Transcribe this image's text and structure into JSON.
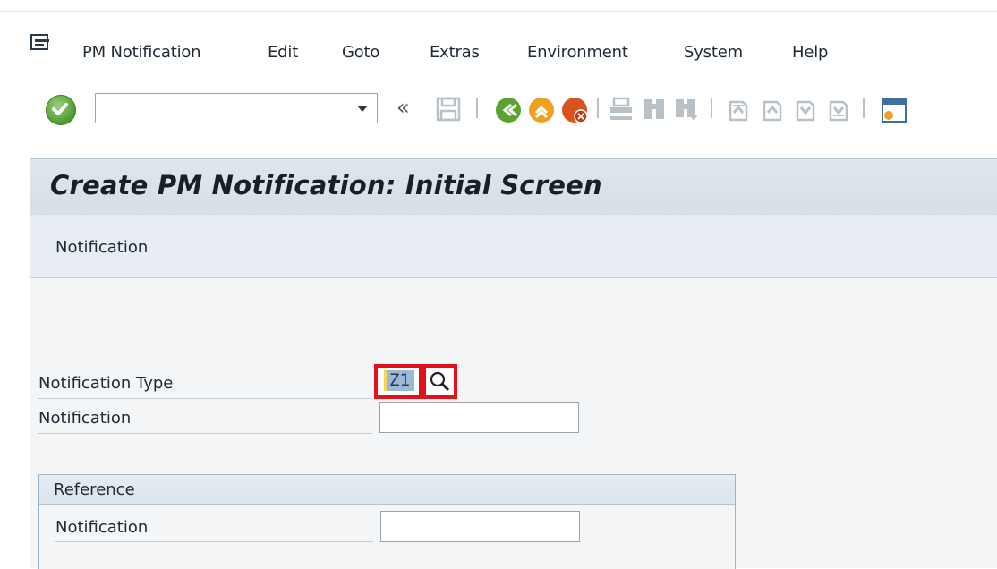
{
  "menubar": {
    "items": [
      {
        "label": "PM Notification"
      },
      {
        "label": "Edit"
      },
      {
        "label": "Goto"
      },
      {
        "label": "Extras"
      },
      {
        "label": "Environment"
      },
      {
        "label": "System"
      },
      {
        "label": "Help"
      }
    ]
  },
  "toolbar": {
    "command_value": "",
    "icons": [
      "enter-icon",
      "back-double-icon",
      "save-icon",
      "back-icon",
      "exit-icon",
      "cancel-icon",
      "print-icon",
      "find-icon",
      "find-next-icon",
      "first-page-icon",
      "previous-page-icon",
      "next-page-icon",
      "last-page-icon",
      "layout-icon"
    ]
  },
  "screen": {
    "title": "Create PM Notification: Initial Screen",
    "subtitle": "Notification"
  },
  "form": {
    "notification_type_label": "Notification Type",
    "notification_type_value": "Z1",
    "notification_label": "Notification",
    "notification_value": ""
  },
  "reference": {
    "title": "Reference",
    "notification_label": "Notification",
    "notification_value": ""
  },
  "colors": {
    "highlight": "#e2121a",
    "title_band": "#dfe7ee",
    "field_selection": "#9bb8d6"
  }
}
